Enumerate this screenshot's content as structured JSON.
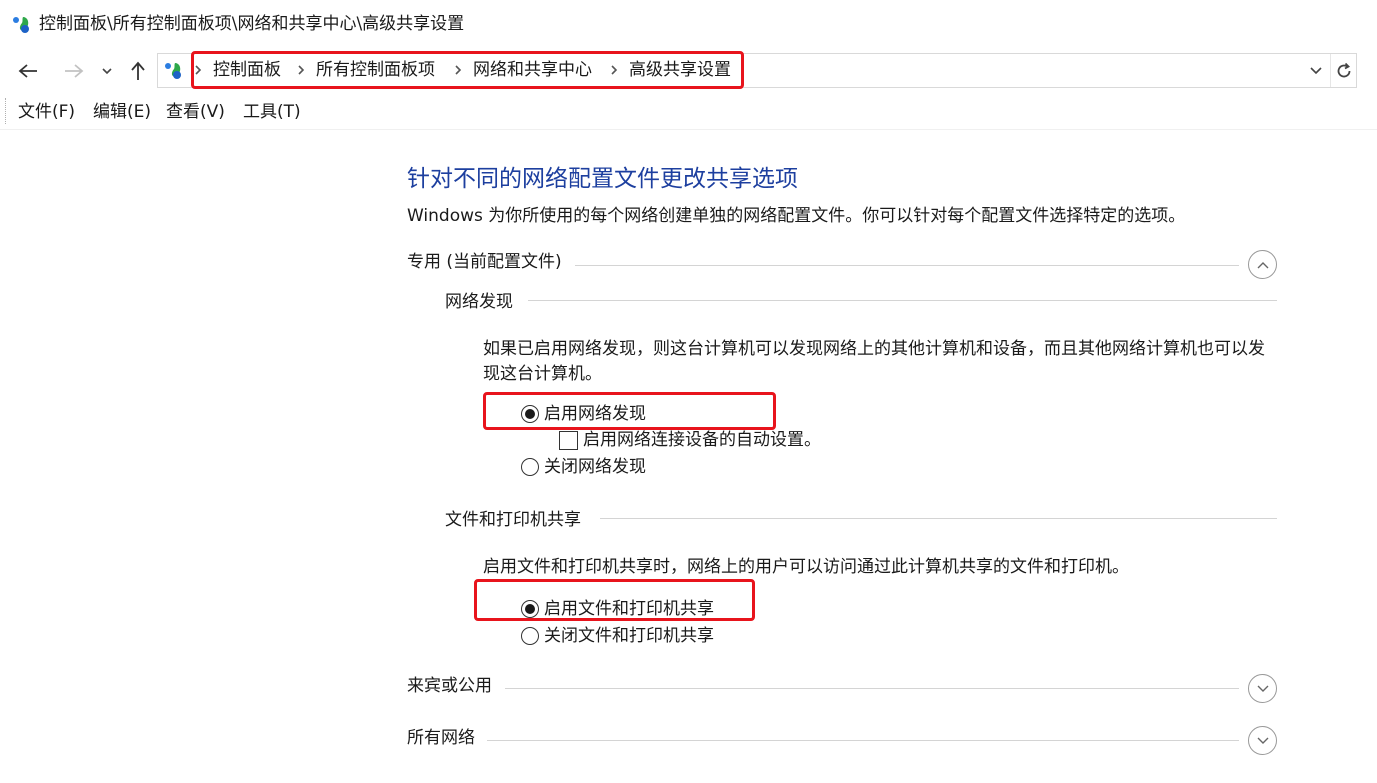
{
  "window": {
    "title": "控制面板\\所有控制面板项\\网络和共享中心\\高级共享设置"
  },
  "navigation": {
    "back_icon": "arrow-left-icon",
    "forward_icon": "arrow-right-icon",
    "recent_icon": "chevron-down-icon",
    "up_icon": "arrow-up-icon",
    "refresh_icon": "refresh-icon"
  },
  "breadcrumb": {
    "items": [
      "控制面板",
      "所有控制面板项",
      "网络和共享中心",
      "高级共享设置"
    ]
  },
  "menu": {
    "file": "文件(F)",
    "edit": "编辑(E)",
    "view": "查看(V)",
    "tools": "工具(T)"
  },
  "main": {
    "heading": "针对不同的网络配置文件更改共享选项",
    "intro": "Windows 为你所使用的每个网络创建单独的网络配置文件。你可以针对每个配置文件选择特定的选项。"
  },
  "profiles": {
    "private": {
      "title": "专用 (当前配置文件)",
      "expanded": true,
      "network_discovery": {
        "title": "网络发现",
        "description": "如果已启用网络发现，则这台计算机可以发现网络上的其他计算机和设备，而且其他网络计算机也可以发现这台计算机。",
        "turn_on_label": "启用网络发现",
        "turn_on_selected": true,
        "auto_setup_label": "启用网络连接设备的自动设置。",
        "auto_setup_checked": false,
        "turn_off_label": "关闭网络发现"
      },
      "file_printer_sharing": {
        "title": "文件和打印机共享",
        "description": "启用文件和打印机共享时，网络上的用户可以访问通过此计算机共享的文件和打印机。",
        "turn_on_label": "启用文件和打印机共享",
        "turn_on_selected": true,
        "turn_off_label": "关闭文件和打印机共享"
      }
    },
    "guest_public": {
      "title": "来宾或公用",
      "expanded": false
    },
    "all_networks": {
      "title": "所有网络",
      "expanded": false
    }
  },
  "colors": {
    "heading": "#1d3f9f",
    "highlight": "#e8141c"
  }
}
